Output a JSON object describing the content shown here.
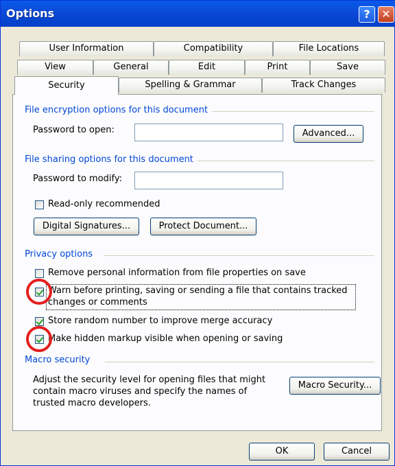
{
  "window": {
    "title": "Options",
    "help_icon": "question-mark-icon",
    "close_icon": "close-icon"
  },
  "tabs": {
    "row1": [
      "User Information",
      "Compatibility",
      "File Locations"
    ],
    "row2": [
      "View",
      "General",
      "Edit",
      "Print",
      "Save"
    ],
    "row3": [
      "Security",
      "Spelling & Grammar",
      "Track Changes"
    ],
    "active": "Security"
  },
  "encryption": {
    "group_label": "File encryption options for this document",
    "password_open_label": "Password to open:",
    "password_open_value": "",
    "advanced_button": "Advanced..."
  },
  "sharing": {
    "group_label": "File sharing options for this document",
    "password_modify_label": "Password to modify:",
    "password_modify_value": "",
    "readonly_label": "Read-only recommended",
    "readonly_checked": false,
    "digital_signatures_button": "Digital Signatures...",
    "protect_document_button": "Protect Document..."
  },
  "privacy": {
    "group_label": "Privacy options",
    "items": [
      {
        "label": "Remove personal information from file properties on save",
        "checked": false
      },
      {
        "label_line1": "Warn before printing, saving or sending a file that contains tracked",
        "label_line2": "changes or comments",
        "checked": true
      },
      {
        "label": "Store random number to improve merge accuracy",
        "checked": true
      },
      {
        "label": "Make hidden markup visible when opening or saving",
        "checked": true
      }
    ]
  },
  "macro": {
    "group_label": "Macro security",
    "desc_line1": "Adjust the security level for opening files that might",
    "desc_line2": "contain macro viruses and specify the names of",
    "desc_line3": "trusted macro developers.",
    "button": "Macro Security..."
  },
  "footer": {
    "ok_button": "OK",
    "cancel_button": "Cancel"
  },
  "colors": {
    "title_bar": "#0B49D6",
    "group_label": "#0046D5",
    "highlight_circle": "#E41E1E",
    "checkmark": "#21A121"
  }
}
